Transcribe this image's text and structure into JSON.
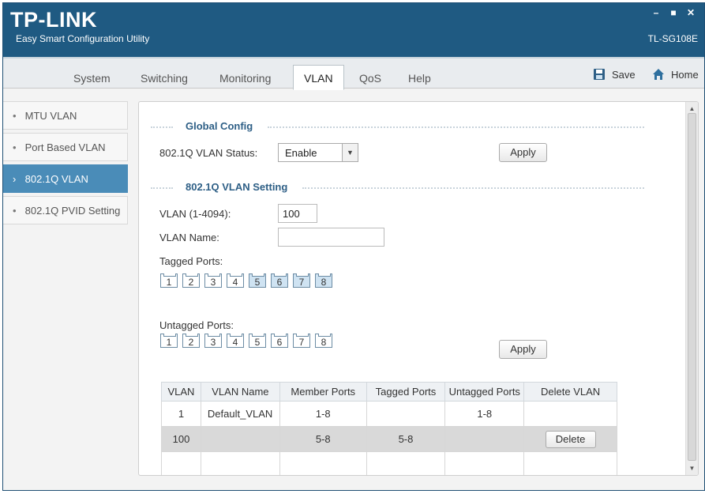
{
  "window": {
    "logo": "TP-LINK",
    "subtitle": "Easy Smart Configuration Utility",
    "model": "TL-SG108E",
    "controls": {
      "minimize": "–",
      "maximize": "■",
      "close": "✕"
    }
  },
  "tabs": [
    {
      "label": "System",
      "active": false
    },
    {
      "label": "Switching",
      "active": false
    },
    {
      "label": "Monitoring",
      "active": false
    },
    {
      "label": "VLAN",
      "active": true
    },
    {
      "label": "QoS",
      "active": false
    },
    {
      "label": "Help",
      "active": false
    }
  ],
  "toolbar": {
    "save_label": "Save",
    "home_label": "Home"
  },
  "sidebar": {
    "items": [
      {
        "label": "MTU VLAN",
        "bullet": "•",
        "active": false
      },
      {
        "label": "Port Based VLAN",
        "bullet": "•",
        "active": false
      },
      {
        "label": "802.1Q VLAN",
        "bullet": "›",
        "active": true
      },
      {
        "label": "802.1Q PVID Setting",
        "bullet": "•",
        "active": false
      }
    ]
  },
  "global_config": {
    "title": "Global Config",
    "status_label": "802.1Q VLAN Status:",
    "status_value": "Enable",
    "apply_label": "Apply"
  },
  "vlan_setting": {
    "title": "802.1Q VLAN Setting",
    "vlan_label": "VLAN (1-4094):",
    "vlan_value": "100",
    "name_label": "VLAN Name:",
    "name_value": "",
    "tagged_label": "Tagged Ports:",
    "untagged_label": "Untagged Ports:",
    "tagged_ports": [
      {
        "label": "1",
        "selected": false
      },
      {
        "label": "2",
        "selected": false
      },
      {
        "label": "3",
        "selected": false
      },
      {
        "label": "4",
        "selected": false
      },
      {
        "label": "5",
        "selected": true
      },
      {
        "label": "6",
        "selected": true
      },
      {
        "label": "7",
        "selected": true
      },
      {
        "label": "8",
        "selected": true
      }
    ],
    "untagged_ports": [
      {
        "label": "1",
        "selected": false
      },
      {
        "label": "2",
        "selected": false
      },
      {
        "label": "3",
        "selected": false
      },
      {
        "label": "4",
        "selected": false
      },
      {
        "label": "5",
        "selected": false
      },
      {
        "label": "6",
        "selected": false
      },
      {
        "label": "7",
        "selected": false
      },
      {
        "label": "8",
        "selected": false
      }
    ],
    "apply_label": "Apply"
  },
  "table": {
    "headers": [
      "VLAN",
      "VLAN Name",
      "Member Ports",
      "Tagged Ports",
      "Untagged Ports",
      "Delete VLAN"
    ],
    "rows": [
      {
        "vlan": "1",
        "name": "Default_VLAN",
        "member": "1-8",
        "tagged": "",
        "untagged": "1-8",
        "delete": "",
        "selected": false
      },
      {
        "vlan": "100",
        "name": "",
        "member": "5-8",
        "tagged": "5-8",
        "untagged": "",
        "delete": "Delete",
        "selected": true
      },
      {
        "vlan": "",
        "name": "",
        "member": "",
        "tagged": "",
        "untagged": "",
        "delete": "",
        "selected": false
      }
    ]
  },
  "colors": {
    "title_bar": "#1f5a82",
    "active_sidebar": "#4a8cb8",
    "section_title": "#2e5f86"
  }
}
